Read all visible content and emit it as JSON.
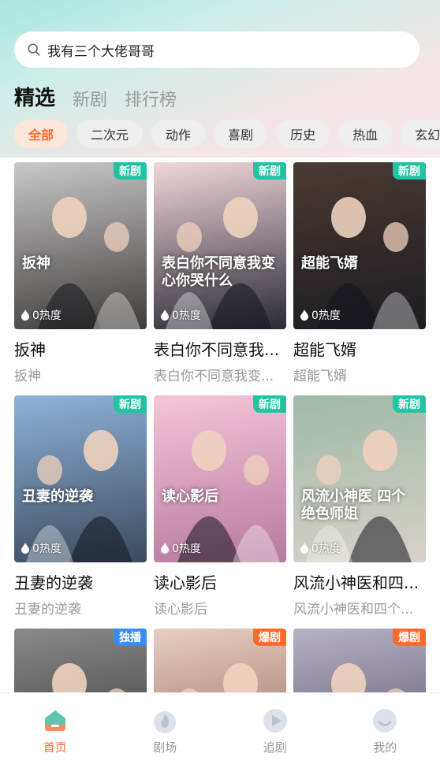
{
  "search": {
    "placeholder": "我有三个大佬哥哥"
  },
  "tabs": [
    {
      "label": "精选",
      "active": true
    },
    {
      "label": "新剧",
      "active": false
    },
    {
      "label": "排行榜",
      "active": false
    }
  ],
  "chips": [
    {
      "label": "全部",
      "active": true
    },
    {
      "label": "二次元"
    },
    {
      "label": "动作"
    },
    {
      "label": "喜剧"
    },
    {
      "label": "历史"
    },
    {
      "label": "热血"
    },
    {
      "label": "玄幻"
    }
  ],
  "dramas": [
    {
      "title": "扳神",
      "subtitle": "扳神",
      "tag": "新剧",
      "heat": "0热度",
      "poster_text": "扳神",
      "colors": [
        "#c9c9c9",
        "#3f3b3a"
      ]
    },
    {
      "title": "表白你不同意我...",
      "subtitle": "表白你不同意我变...",
      "tag": "新剧",
      "heat": "0热度",
      "poster_text": "表白你不同意我变心你哭什么",
      "colors": [
        "#f2d7dc",
        "#2a2a35"
      ]
    },
    {
      "title": "超能飞婿",
      "subtitle": "超能飞婿",
      "tag": "新剧",
      "heat": "0热度",
      "poster_text": "超能飞婿",
      "colors": [
        "#4a3a32",
        "#1c1c22"
      ]
    },
    {
      "title": "丑妻的逆袭",
      "subtitle": "丑妻的逆袭",
      "tag": "新剧",
      "heat": "0热度",
      "poster_text": "丑妻的逆袭",
      "colors": [
        "#8fb3d9",
        "#3b4a5e"
      ]
    },
    {
      "title": "读心影后",
      "subtitle": "读心影后",
      "tag": "新剧",
      "heat": "0热度",
      "poster_text": "读心影后",
      "colors": [
        "#f5c6d8",
        "#b77a9e"
      ]
    },
    {
      "title": "风流小神医和四...",
      "subtitle": "风流小神医和四个...",
      "tag": "新剧",
      "heat": "0热度",
      "poster_text": "风流小神医 四个绝色师姐",
      "colors": [
        "#9fb9a8",
        "#d8d2c8"
      ]
    },
    {
      "title": "",
      "subtitle": "",
      "tag": "独播",
      "heat": "",
      "poster_text": "",
      "colors": [
        "#8a8a8a",
        "#2b2b2b"
      ]
    },
    {
      "title": "",
      "subtitle": "",
      "tag": "爆剧",
      "heat": "",
      "poster_text": "",
      "colors": [
        "#e8cfc3",
        "#8a5a4a"
      ]
    },
    {
      "title": "",
      "subtitle": "",
      "tag": "爆剧",
      "heat": "",
      "poster_text": "",
      "colors": [
        "#b8b2c8",
        "#4a4656"
      ]
    }
  ],
  "nav": [
    {
      "label": "首页",
      "icon": "home-icon",
      "active": true
    },
    {
      "label": "剧场",
      "icon": "theater-icon",
      "active": false
    },
    {
      "label": "追剧",
      "icon": "play-icon",
      "active": false
    },
    {
      "label": "我的",
      "icon": "profile-icon",
      "active": false
    }
  ],
  "colors": {
    "accent": "#ff6a2c",
    "tag_new": "#1fc5a3",
    "tag_exclusive": "#3b8cf2",
    "tag_hot": "#ff6a2c"
  }
}
